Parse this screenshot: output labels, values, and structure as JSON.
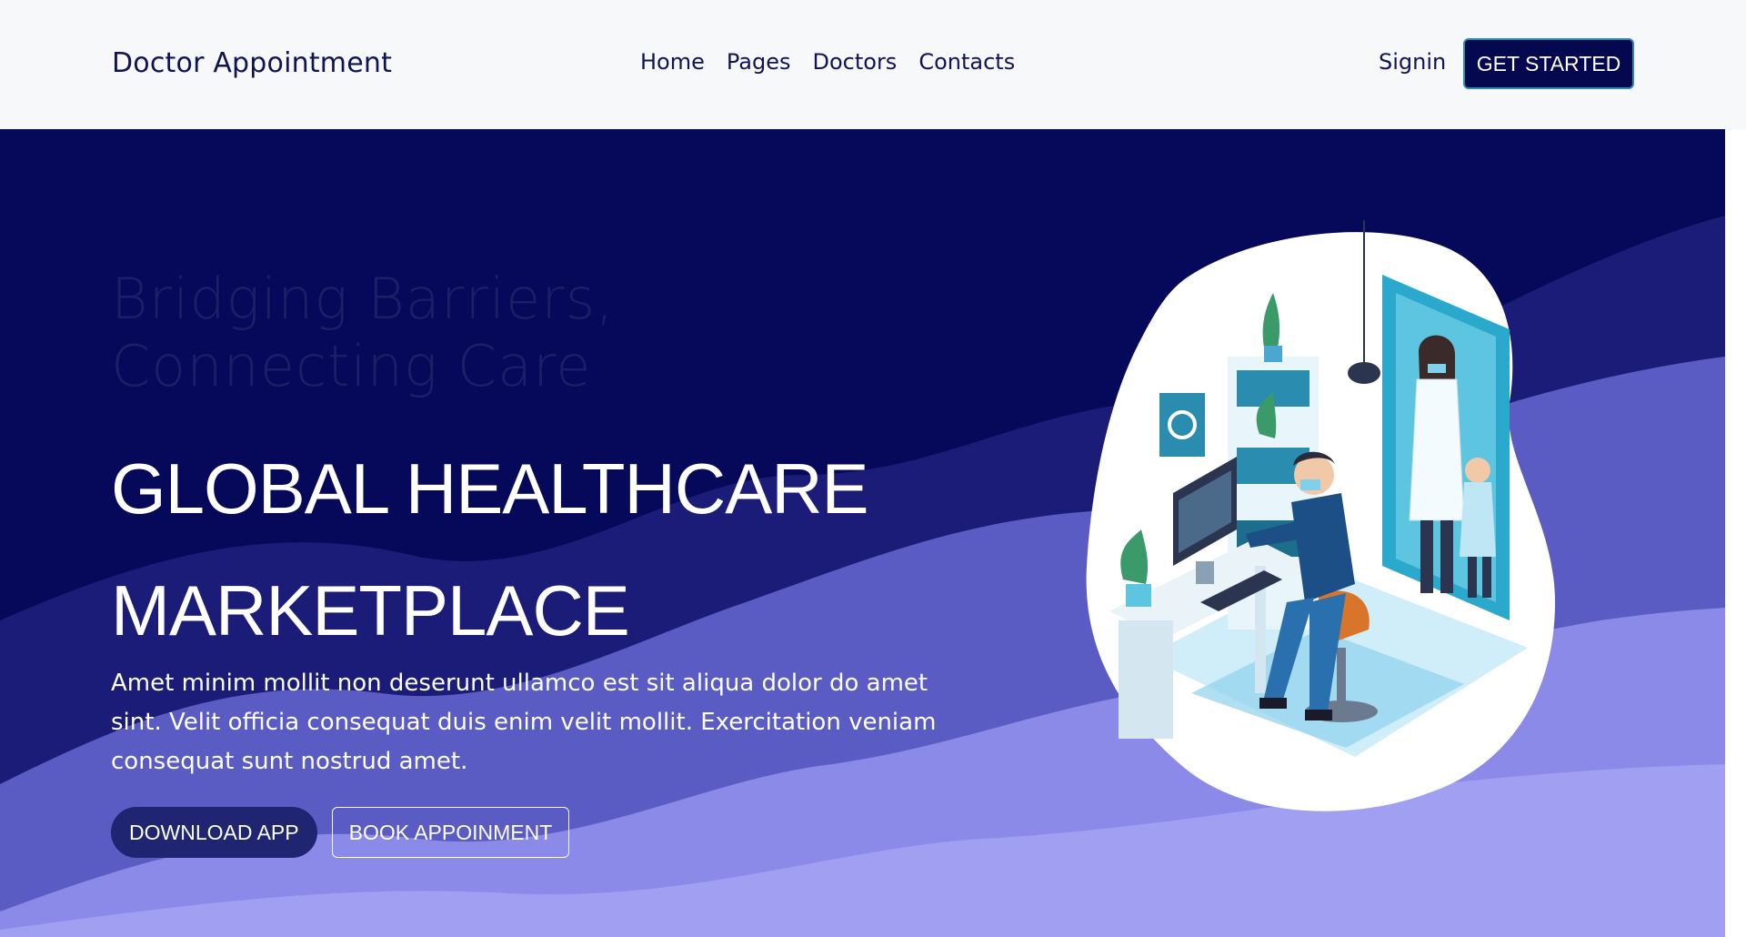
{
  "nav": {
    "brand": "Doctor Appointment",
    "links": [
      "Home",
      "Pages",
      "Doctors",
      "Contacts"
    ],
    "signin": "Signin",
    "cta": "GET STARTED"
  },
  "hero": {
    "tagline": "Bridging Barriers, Connecting Care",
    "headline_line1": "GLOBAL HEALTHCARE",
    "headline_line2": "MARKETPLACE",
    "description": "Amet minim mollit non deserunt ullamco est sit aliqua dolor do amet sint. Velit officia consequat duis enim velit mollit. Exercitation veniam consequat sunt nostrud amet.",
    "download_button": "DOWNLOAD APP",
    "book_button": "BOOK APPOINMENT"
  },
  "colors": {
    "navy": "#06085a",
    "brand_text": "#0e1454",
    "wave_light": "#a09ff2",
    "wave_mid": "#5b5bc4",
    "accent_teal": "#2a8cae"
  }
}
